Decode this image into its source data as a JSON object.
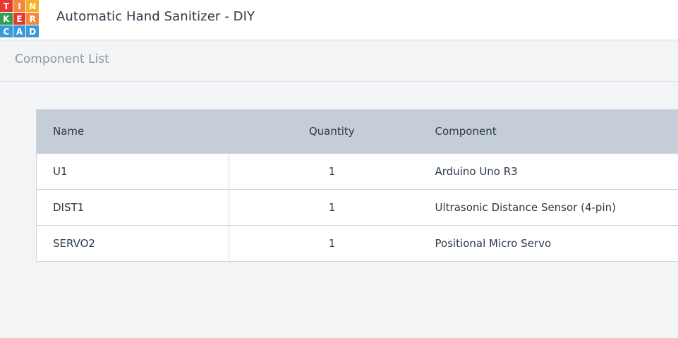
{
  "logo": {
    "letters": [
      "T",
      "I",
      "N",
      "K",
      "E",
      "R",
      "C",
      "A",
      "D"
    ],
    "colors": [
      "#e8382f",
      "#f4893c",
      "#f5b02a",
      "#2f9e4f",
      "#e8382f",
      "#f4893c",
      "#3a9ad9",
      "#3a9ad9",
      "#3a9ad9"
    ]
  },
  "header": {
    "title": "Automatic Hand Sanitizer - DIY"
  },
  "section": {
    "title": "Component List"
  },
  "table": {
    "columns": [
      "Name",
      "Quantity",
      "Component"
    ],
    "rows": [
      {
        "name": "U1",
        "quantity": "1",
        "component": "Arduino Uno R3"
      },
      {
        "name": "DIST1",
        "quantity": "1",
        "component": "Ultrasonic Distance Sensor (4-pin)"
      },
      {
        "name": "SERVO2",
        "quantity": "1",
        "component": "Positional Micro Servo"
      }
    ]
  }
}
